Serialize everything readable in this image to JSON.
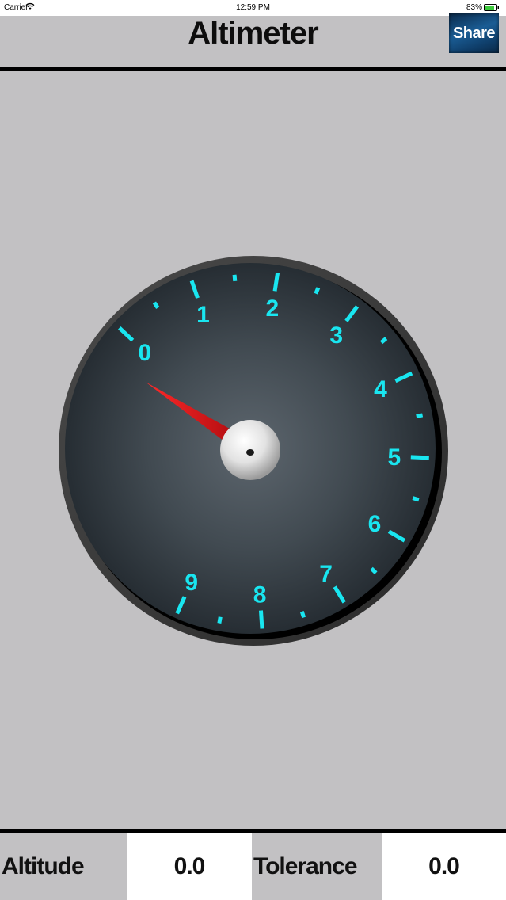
{
  "status_bar": {
    "carrier": "Carrier",
    "time": "12:59 PM",
    "battery": "83%"
  },
  "header": {
    "title": "Altimeter",
    "share_label": "Share"
  },
  "gauge": {
    "labels": [
      "0",
      "1",
      "2",
      "3",
      "4",
      "5",
      "6",
      "7",
      "8",
      "9"
    ],
    "needle_value": 0,
    "dial_color": "#3b444b",
    "tick_color": "#19e6f0",
    "needle_color": "#e01418"
  },
  "footer": {
    "altitude_label": "Altitude",
    "altitude_value": "0.0",
    "tolerance_label": "Tolerance",
    "tolerance_value": "0.0"
  },
  "colors": {
    "background": "#c2c1c3",
    "accent": "#19e6f0"
  }
}
